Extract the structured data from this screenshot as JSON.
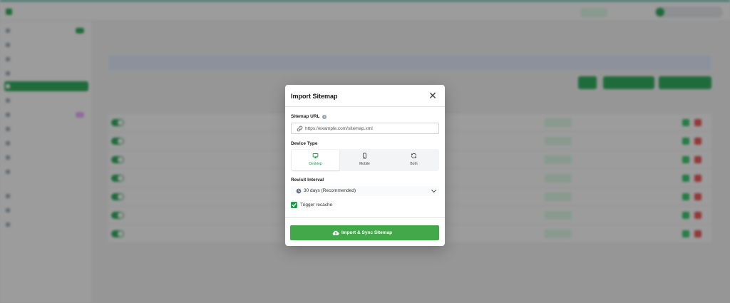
{
  "colors": {
    "accent": "#16a34a",
    "button": "#43a849",
    "overlay": "rgba(45,45,45,0.47)",
    "danger": "#ef4444",
    "info_bar": "#e0ecff"
  },
  "modal": {
    "title": "Import Sitemap",
    "close_icon": "close-x-icon",
    "sitemap_url": {
      "label": "Sitemap URL",
      "info_icon": "info-icon",
      "placeholder": "https://example.com/sitemap.xml",
      "value": "",
      "icon": "link-icon"
    },
    "device_type": {
      "label": "Device Type",
      "options": [
        {
          "label": "Desktop",
          "icon": "desktop-icon",
          "selected": true
        },
        {
          "label": "Mobile",
          "icon": "mobile-icon",
          "selected": false
        },
        {
          "label": "Both",
          "icon": "refresh-icon",
          "selected": false
        }
      ]
    },
    "revisit_interval": {
      "label": "Revisit Interval",
      "selected": "30 days (Recommended)",
      "icon": "clock-icon"
    },
    "trigger_recache": {
      "label": "Trigger recache",
      "checked": true
    },
    "submit": {
      "label": "Import & Sync Sitemap",
      "icon": "cloud-upload-icon"
    }
  }
}
